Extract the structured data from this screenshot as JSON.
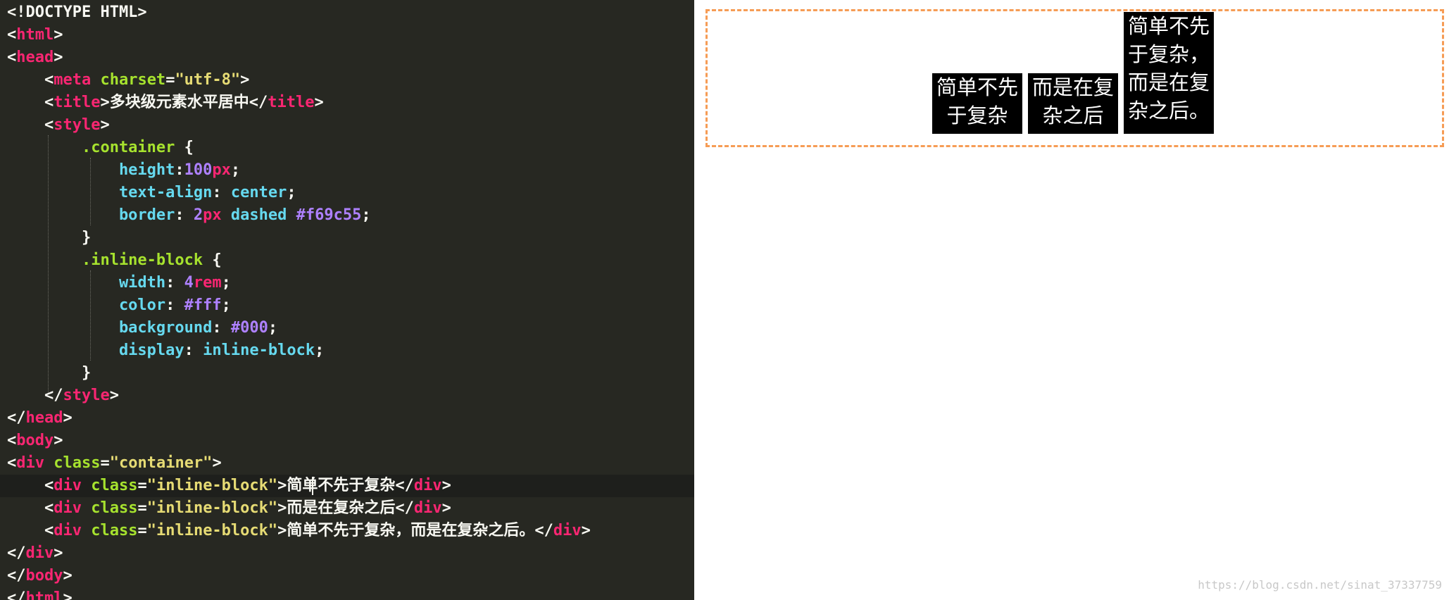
{
  "editor": {
    "colors": {
      "background": "#272822",
      "tag": "#f92672",
      "attribute": "#a6e22e",
      "string": "#e6db74",
      "plain": "#f8f8f2",
      "property": "#66d9ef",
      "number": "#ae81ff"
    },
    "lines": [
      [
        {
          "t": "<!DOCTYPE HTML>",
          "c": "plain"
        }
      ],
      [
        {
          "t": "<",
          "c": "plain"
        },
        {
          "t": "html",
          "c": "tag"
        },
        {
          "t": ">",
          "c": "plain"
        }
      ],
      [
        {
          "t": "<",
          "c": "plain"
        },
        {
          "t": "head",
          "c": "tag"
        },
        {
          "t": ">",
          "c": "plain"
        }
      ],
      [
        {
          "t": "    <",
          "c": "plain"
        },
        {
          "t": "meta",
          "c": "tag"
        },
        {
          "t": " charset",
          "c": "attribute"
        },
        {
          "t": "=",
          "c": "plain"
        },
        {
          "t": "\"utf-8\"",
          "c": "string"
        },
        {
          "t": ">",
          "c": "plain"
        }
      ],
      [
        {
          "t": "    <",
          "c": "plain"
        },
        {
          "t": "title",
          "c": "tag"
        },
        {
          "t": ">多块级元素水平居中</",
          "c": "plain"
        },
        {
          "t": "title",
          "c": "tag"
        },
        {
          "t": ">",
          "c": "plain"
        }
      ],
      [
        {
          "t": "    <",
          "c": "plain"
        },
        {
          "t": "style",
          "c": "tag"
        },
        {
          "t": ">",
          "c": "plain"
        }
      ],
      [
        {
          "t": "        .container ",
          "c": "attribute"
        },
        {
          "t": "{",
          "c": "plain"
        }
      ],
      [
        {
          "t": "            height",
          "c": "property"
        },
        {
          "t": ":",
          "c": "plain"
        },
        {
          "t": "100",
          "c": "number"
        },
        {
          "t": "px",
          "c": "tag"
        },
        {
          "t": ";",
          "c": "plain"
        }
      ],
      [
        {
          "t": "            text-align",
          "c": "property"
        },
        {
          "t": ": ",
          "c": "plain"
        },
        {
          "t": "center",
          "c": "property"
        },
        {
          "t": ";",
          "c": "plain"
        }
      ],
      [
        {
          "t": "            border",
          "c": "property"
        },
        {
          "t": ": ",
          "c": "plain"
        },
        {
          "t": "2",
          "c": "number"
        },
        {
          "t": "px",
          "c": "tag"
        },
        {
          "t": " dashed ",
          "c": "property"
        },
        {
          "t": "#f69c55",
          "c": "number"
        },
        {
          "t": ";",
          "c": "plain"
        }
      ],
      [
        {
          "t": "        }",
          "c": "plain"
        }
      ],
      [
        {
          "t": "        .inline-block ",
          "c": "attribute"
        },
        {
          "t": "{",
          "c": "plain"
        }
      ],
      [
        {
          "t": "            width",
          "c": "property"
        },
        {
          "t": ": ",
          "c": "plain"
        },
        {
          "t": "4",
          "c": "number"
        },
        {
          "t": "rem",
          "c": "tag"
        },
        {
          "t": ";",
          "c": "plain"
        }
      ],
      [
        {
          "t": "            color",
          "c": "property"
        },
        {
          "t": ": ",
          "c": "plain"
        },
        {
          "t": "#fff",
          "c": "number"
        },
        {
          "t": ";",
          "c": "plain"
        }
      ],
      [
        {
          "t": "            background",
          "c": "property"
        },
        {
          "t": ": ",
          "c": "plain"
        },
        {
          "t": "#000",
          "c": "number"
        },
        {
          "t": ";",
          "c": "plain"
        }
      ],
      [
        {
          "t": "            display",
          "c": "property"
        },
        {
          "t": ": ",
          "c": "plain"
        },
        {
          "t": "inline-block",
          "c": "property"
        },
        {
          "t": ";",
          "c": "plain"
        }
      ],
      [
        {
          "t": "        }",
          "c": "plain"
        }
      ],
      [
        {
          "t": "    </",
          "c": "plain"
        },
        {
          "t": "style",
          "c": "tag"
        },
        {
          "t": ">",
          "c": "plain"
        }
      ],
      [
        {
          "t": "</",
          "c": "plain"
        },
        {
          "t": "head",
          "c": "tag"
        },
        {
          "t": ">",
          "c": "plain"
        }
      ],
      [
        {
          "t": "<",
          "c": "plain"
        },
        {
          "t": "body",
          "c": "tag"
        },
        {
          "t": ">",
          "c": "plain"
        }
      ],
      [
        {
          "t": "<",
          "c": "plain"
        },
        {
          "t": "div",
          "c": "tag"
        },
        {
          "t": " class",
          "c": "attribute"
        },
        {
          "t": "=",
          "c": "plain"
        },
        {
          "t": "\"container\"",
          "c": "string"
        },
        {
          "t": ">",
          "c": "plain"
        }
      ],
      [
        {
          "t": "    <",
          "c": "plain"
        },
        {
          "t": "div",
          "c": "tag"
        },
        {
          "t": " class",
          "c": "attribute"
        },
        {
          "t": "=",
          "c": "plain"
        },
        {
          "t": "\"inline-block\"",
          "c": "string"
        },
        {
          "t": ">简单不先于复杂</",
          "c": "plain"
        },
        {
          "t": "div",
          "c": "tag"
        },
        {
          "t": ">",
          "c": "plain"
        }
      ],
      [
        {
          "t": "    <",
          "c": "plain"
        },
        {
          "t": "div",
          "c": "tag"
        },
        {
          "t": " class",
          "c": "attribute"
        },
        {
          "t": "=",
          "c": "plain"
        },
        {
          "t": "\"inline-block\"",
          "c": "string"
        },
        {
          "t": ">而是在复杂之后</",
          "c": "plain"
        },
        {
          "t": "div",
          "c": "tag"
        },
        {
          "t": ">",
          "c": "plain"
        }
      ],
      [
        {
          "t": "    <",
          "c": "plain"
        },
        {
          "t": "div",
          "c": "tag"
        },
        {
          "t": " class",
          "c": "attribute"
        },
        {
          "t": "=",
          "c": "plain"
        },
        {
          "t": "\"inline-block\"",
          "c": "string"
        },
        {
          "t": ">简单不先于复杂，而是在复杂之后。</",
          "c": "plain"
        },
        {
          "t": "div",
          "c": "tag"
        },
        {
          "t": ">",
          "c": "plain"
        }
      ],
      [
        {
          "t": "</",
          "c": "plain"
        },
        {
          "t": "div",
          "c": "tag"
        },
        {
          "t": ">",
          "c": "plain"
        }
      ],
      [
        {
          "t": "</",
          "c": "plain"
        },
        {
          "t": "body",
          "c": "tag"
        },
        {
          "t": ">",
          "c": "plain"
        }
      ],
      [
        {
          "t": "</",
          "c": "plain"
        },
        {
          "t": "html",
          "c": "tag"
        },
        {
          "t": ">",
          "c": "plain"
        }
      ]
    ]
  },
  "preview": {
    "container_border_color": "#f69c55",
    "blocks": [
      {
        "text": "简单不先于复杂"
      },
      {
        "text": "而是在复杂之后"
      },
      {
        "text": "简单不先于复杂，而是在复杂之后。"
      }
    ],
    "watermark": "https://blog.csdn.net/sinat_37337759"
  }
}
